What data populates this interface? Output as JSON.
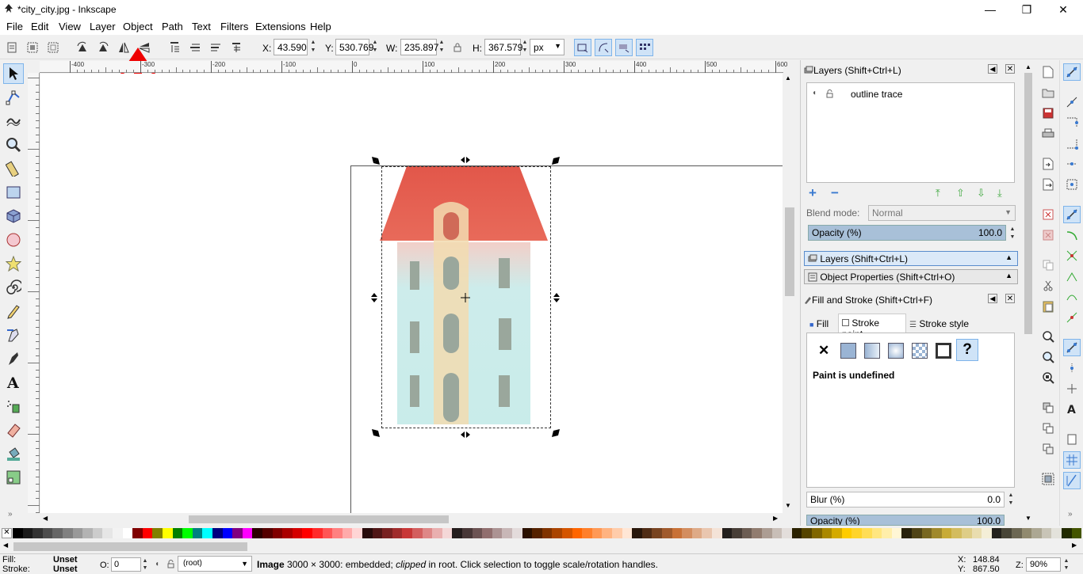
{
  "window": {
    "title": "*city_city.jpg - Inkscape"
  },
  "menu": [
    "File",
    "Edit",
    "View",
    "Layer",
    "Object",
    "Path",
    "Text",
    "Filters",
    "Extensions",
    "Help"
  ],
  "controls": {
    "x_label": "X:",
    "x_value": "43.590",
    "y_label": "Y:",
    "y_value": "530.769",
    "w_label": "W:",
    "w_value": "235.897",
    "h_label": "H:",
    "h_value": "367.579",
    "unit": "px"
  },
  "ruler_labels": [
    "-400",
    "-300",
    "-200",
    "-100",
    "0",
    "100",
    "200",
    "300",
    "400",
    "500",
    "600"
  ],
  "layers_panel": {
    "title": "Layers (Shift+Ctrl+L)",
    "layer_name": "outline trace",
    "blend_label": "Blend mode:",
    "blend_value": "Normal",
    "opacity_label": "Opacity (%)",
    "opacity_value": "100.0",
    "tab_layers": "Layers (Shift+Ctrl+L)",
    "tab_object_props": "Object Properties (Shift+Ctrl+O)"
  },
  "fill_stroke_panel": {
    "title": "Fill and Stroke (Shift+Ctrl+F)",
    "tab_fill": "Fill",
    "tab_stroke_paint": "Stroke paint",
    "tab_stroke_style": "Stroke style",
    "paint_message": "Paint is undefined",
    "blur_label": "Blur (%)",
    "blur_value": "0.0",
    "opacity_label": "Opacity (%)",
    "opacity_value": "100.0"
  },
  "status": {
    "fill_label": "Fill:",
    "fill_value": "Unset",
    "stroke_label": "Stroke:",
    "stroke_value": "Unset",
    "o_label": "O:",
    "o_value": "0",
    "layer_select": "(root)",
    "message_bold": "Image",
    "message_1": " 3000 × 3000: embedded; ",
    "message_italic": "clipped",
    "message_2": " in root. Click selection to toggle scale/rotation handles.",
    "cursor_x_label": "X:",
    "cursor_x": "148.84",
    "cursor_y_label": "Y:",
    "cursor_y": "867.50",
    "zoom_label": "Z:",
    "zoom_value": "90%"
  },
  "colors": {
    "selection_bg": "#cfe3f7",
    "annotation_arrow": "#ee0000",
    "roof": "#e2574a",
    "building": "#c9ecea",
    "tower": "#f2dcb0",
    "windows": "#9aa79c"
  },
  "palette": [
    "#000000",
    "#1a1a1a",
    "#333333",
    "#4d4d4d",
    "#666666",
    "#808080",
    "#999999",
    "#b3b3b3",
    "#cccccc",
    "#e6e6e6",
    "#f2f2f2",
    "#ffffff",
    "#800000",
    "#ff0000",
    "#808000",
    "#ffff00",
    "#008000",
    "#00ff00",
    "#008080",
    "#00ffff",
    "#000080",
    "#0000ff",
    "#800080",
    "#ff00ff",
    "#2b0000",
    "#550000",
    "#800000",
    "#aa0000",
    "#d40000",
    "#ff0000",
    "#ff2a2a",
    "#ff5555",
    "#ff8080",
    "#ffaaaa",
    "#ffd5d5",
    "#280b0b",
    "#501616",
    "#782121",
    "#a02c2c",
    "#c83737",
    "#d35f5f",
    "#de8787",
    "#e9afaf",
    "#f4d7d7",
    "#241c1c",
    "#483737",
    "#6c5353",
    "#916f6f",
    "#ac9393",
    "#c8b7b7",
    "#e3dbdb",
    "#2b1100",
    "#552200",
    "#803300",
    "#aa4400",
    "#d45500",
    "#ff6600",
    "#ff7f2a",
    "#ff9955",
    "#ffb380",
    "#ffccaa",
    "#ffe6d5",
    "#28170b",
    "#502d16",
    "#784421",
    "#a05a2c",
    "#c87137",
    "#d38d5f",
    "#deaa87",
    "#e9c6af",
    "#f4e3d7",
    "#241f1c",
    "#483e37",
    "#6c5d53",
    "#917c6f",
    "#ac9d93",
    "#c8beb7",
    "#e3dedb",
    "#2b2200",
    "#554400",
    "#806600",
    "#aa8800",
    "#d4aa00",
    "#ffcc00",
    "#ffd42a",
    "#ffdd55",
    "#ffe680",
    "#ffeeaa",
    "#fff6d5",
    "#28220b",
    "#504416",
    "#786721",
    "#a0892c",
    "#c8ab37",
    "#d3bc5f",
    "#decd87",
    "#e9ddaf",
    "#f4eed7",
    "#24221c",
    "#484537",
    "#6c6753",
    "#918a6f",
    "#aca793",
    "#c8c4b7",
    "#e3e2db",
    "#222b00",
    "#445500",
    "#668000",
    "#88aa00",
    "#aad400",
    "#ccff00",
    "#d4ff2a",
    "#ddff55",
    "#e5ff80",
    "#eeffaa",
    "#f6ffd5"
  ]
}
